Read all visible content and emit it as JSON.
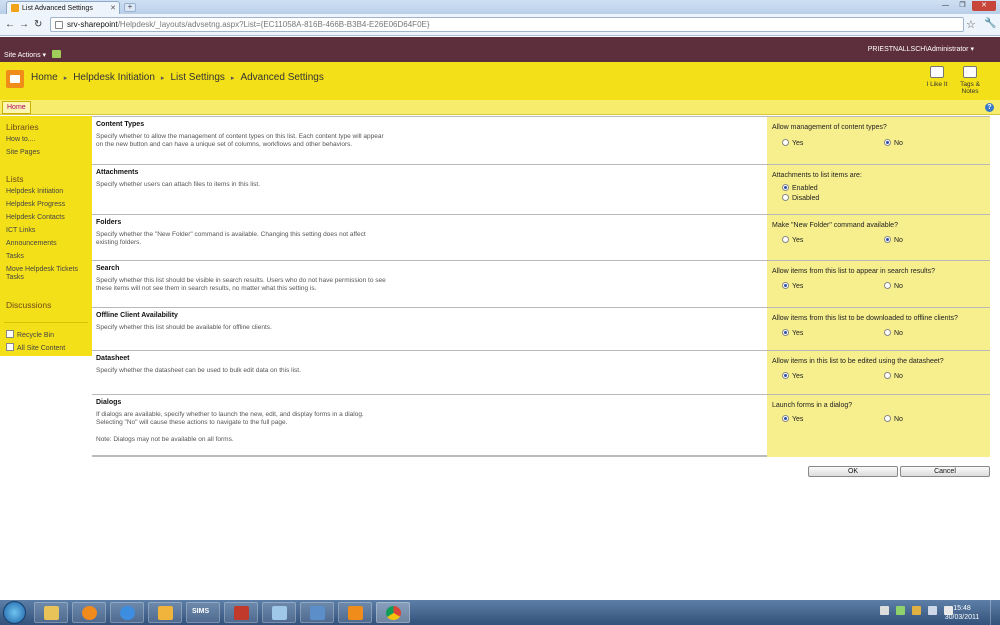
{
  "browser": {
    "tab_title": "List Advanced Settings",
    "url_host": "srv-sharepoint",
    "url_path": "/Helpdesk/_layouts/advsetng.aspx?List={EC11058A-816B-466B-B3B4-E26E06D64F0E}"
  },
  "sp": {
    "site_actions": "Site Actions",
    "user": "PRIESTNALLSCH\\Administrator",
    "breadcrumb": [
      "Home",
      "Helpdesk Initiation",
      "List Settings",
      "Advanced Settings"
    ],
    "i_like_it": "I Like It",
    "tags_notes": "Tags & Notes",
    "home_tab": "Home"
  },
  "quicklaunch": {
    "libraries": "Libraries",
    "lib_items": [
      "How to....",
      "Site Pages"
    ],
    "lists": "Lists",
    "list_items": [
      "Helpdesk Initiation",
      "Helpdesk Progress",
      "Helpdesk Contacts",
      "ICT Links",
      "Announcements",
      "Tasks",
      "Move Helpdesk Tickets",
      "Tasks"
    ],
    "discussions": "Discussions",
    "recycle": "Recycle Bin",
    "all_content": "All Site Content"
  },
  "sections": {
    "content_types": {
      "title": "Content Types",
      "desc": "Specify whether to allow the management of content types on this list. Each content type will appear on the new button and can have a unique set of columns, workflows and other behaviors.",
      "question": "Allow management of content types?",
      "opt1": "Yes",
      "opt2": "No"
    },
    "attachments": {
      "title": "Attachments",
      "desc": "Specify whether users can attach files to items in this list.",
      "question": "Attachments to list items are:",
      "opt1": "Enabled",
      "opt2": "Disabled"
    },
    "folders": {
      "title": "Folders",
      "desc": "Specify whether the \"New Folder\" command is available. Changing this setting does not affect existing folders.",
      "question": "Make \"New Folder\" command available?",
      "opt1": "Yes",
      "opt2": "No"
    },
    "search": {
      "title": "Search",
      "desc": "Specify whether this list should be visible in search results. Users who do not have permission to see these items will not see them in search results, no matter what this setting is.",
      "question": "Allow items from this list to appear in search results?",
      "opt1": "Yes",
      "opt2": "No"
    },
    "offline": {
      "title": "Offline Client Availability",
      "desc": "Specify whether this list should be available for offline clients.",
      "question": "Allow items from this list to be downloaded to offline clients?",
      "opt1": "Yes",
      "opt2": "No"
    },
    "datasheet": {
      "title": "Datasheet",
      "desc": "Specify whether the datasheet can be used to bulk edit data on this list.",
      "question": "Allow items in this list to be edited using the datasheet?",
      "opt1": "Yes",
      "opt2": "No"
    },
    "dialogs": {
      "title": "Dialogs",
      "desc": "If dialogs are available, specify whether to launch the new, edit, and display forms in a dialog. Selecting \"No\" will cause these actions to navigate to the full page.",
      "note": "Note: Dialogs may not be available on all forms.",
      "question": "Launch forms in a dialog?",
      "opt1": "Yes",
      "opt2": "No"
    }
  },
  "buttons": {
    "ok": "OK",
    "cancel": "Cancel"
  },
  "taskbar": {
    "sims": "SIMS",
    "time": "15:48",
    "date": "30/03/2011"
  }
}
